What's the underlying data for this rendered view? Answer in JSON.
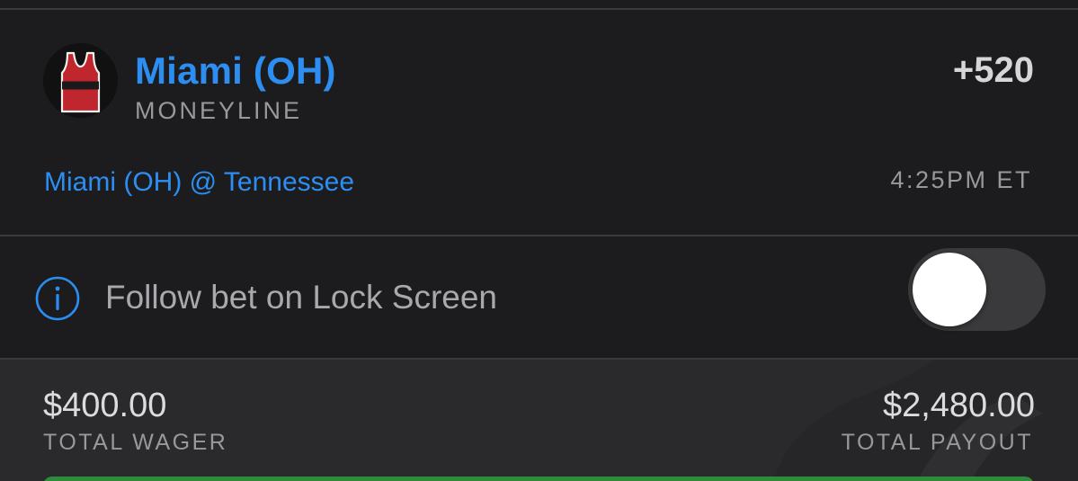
{
  "selection": {
    "team_icon": "basketball-jersey-icon",
    "team_name": "Miami (OH)",
    "market": "MONEYLINE",
    "odds": "+520",
    "matchup": "Miami (OH) @ Tennessee",
    "game_time": "4:25PM ET"
  },
  "follow": {
    "icon": "info-icon",
    "label": "Follow bet on Lock Screen",
    "toggle_on": false
  },
  "totals": {
    "wager_amount": "$400.00",
    "wager_label": "TOTAL WAGER",
    "payout_amount": "$2,480.00",
    "payout_label": "TOTAL PAYOUT"
  },
  "colors": {
    "accent_blue": "#2d8ef2",
    "jersey_red": "#c0262e",
    "place_bet_green": "#2e8b3a"
  }
}
